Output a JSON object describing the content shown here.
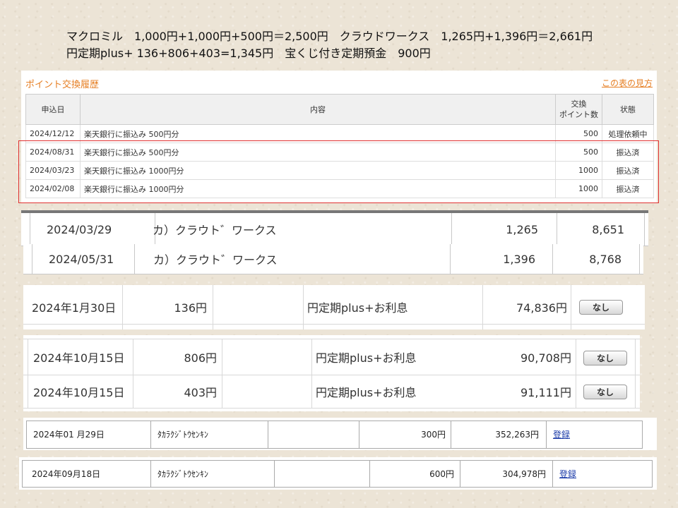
{
  "summary": {
    "line1": "マクロミル　1,000円+1,000円+500円＝2,500円　クラウドワークス　1,265円+1,396円＝2,661円",
    "line2": "円定期plus+ 136+806+403=1,345円　宝くじ付き定期預金　900円"
  },
  "point_history": {
    "title": "ポイント交換履歴",
    "help_link": "この表の見方",
    "headers": {
      "date": "申込日",
      "content": "内容",
      "points_line1": "交換",
      "points_line2": "ポイント数",
      "status": "状態"
    },
    "rows": [
      {
        "date": "2024/12/12",
        "content": "楽天銀行に振込み 500円分",
        "points": "500",
        "status": "処理依頼中"
      },
      {
        "date": "2024/08/31",
        "content": "楽天銀行に振込み 500円分",
        "points": "500",
        "status": "振込済"
      },
      {
        "date": "2024/03/23",
        "content": "楽天銀行に振込み 1000円分",
        "points": "1000",
        "status": "振込済"
      },
      {
        "date": "2024/02/08",
        "content": "楽天銀行に振込み 1000円分",
        "points": "1000",
        "status": "振込済"
      }
    ]
  },
  "crowdworks": [
    {
      "date": "2024/03/29",
      "payer": "カ）クラウト゛ワークス",
      "amount": "1,265",
      "balance": "8,651"
    },
    {
      "date": "2024/05/31",
      "payer": "カ）クラウト゛ワークス",
      "amount": "1,396",
      "balance": "8,768"
    }
  ],
  "yen_plus": [
    {
      "date": "2024年1月30日",
      "amount": "136円",
      "desc": "円定期plus+お利息",
      "balance": "74,836円",
      "button": "なし"
    },
    {
      "date": "2024年10月15日",
      "amount": "806円",
      "desc": "円定期plus+お利息",
      "balance": "90,708円",
      "button": "なし"
    },
    {
      "date": "2024年10月15日",
      "amount": "403円",
      "desc": "円定期plus+お利息",
      "balance": "91,111円",
      "button": "なし"
    }
  ],
  "lottery": [
    {
      "date": "2024年01 月29日",
      "payer": "ﾀｶﾗｸｼﾞﾄｳｾﾝｷﾝ",
      "amount": "300円",
      "balance": "352,263円",
      "link": "登録"
    },
    {
      "date": "2024年09月18日",
      "payer": "ﾀｶﾗｸｼﾞﾄｳｾﾝｷﾝ",
      "amount": "600円",
      "balance": "304,978円",
      "link": "登録"
    }
  ]
}
